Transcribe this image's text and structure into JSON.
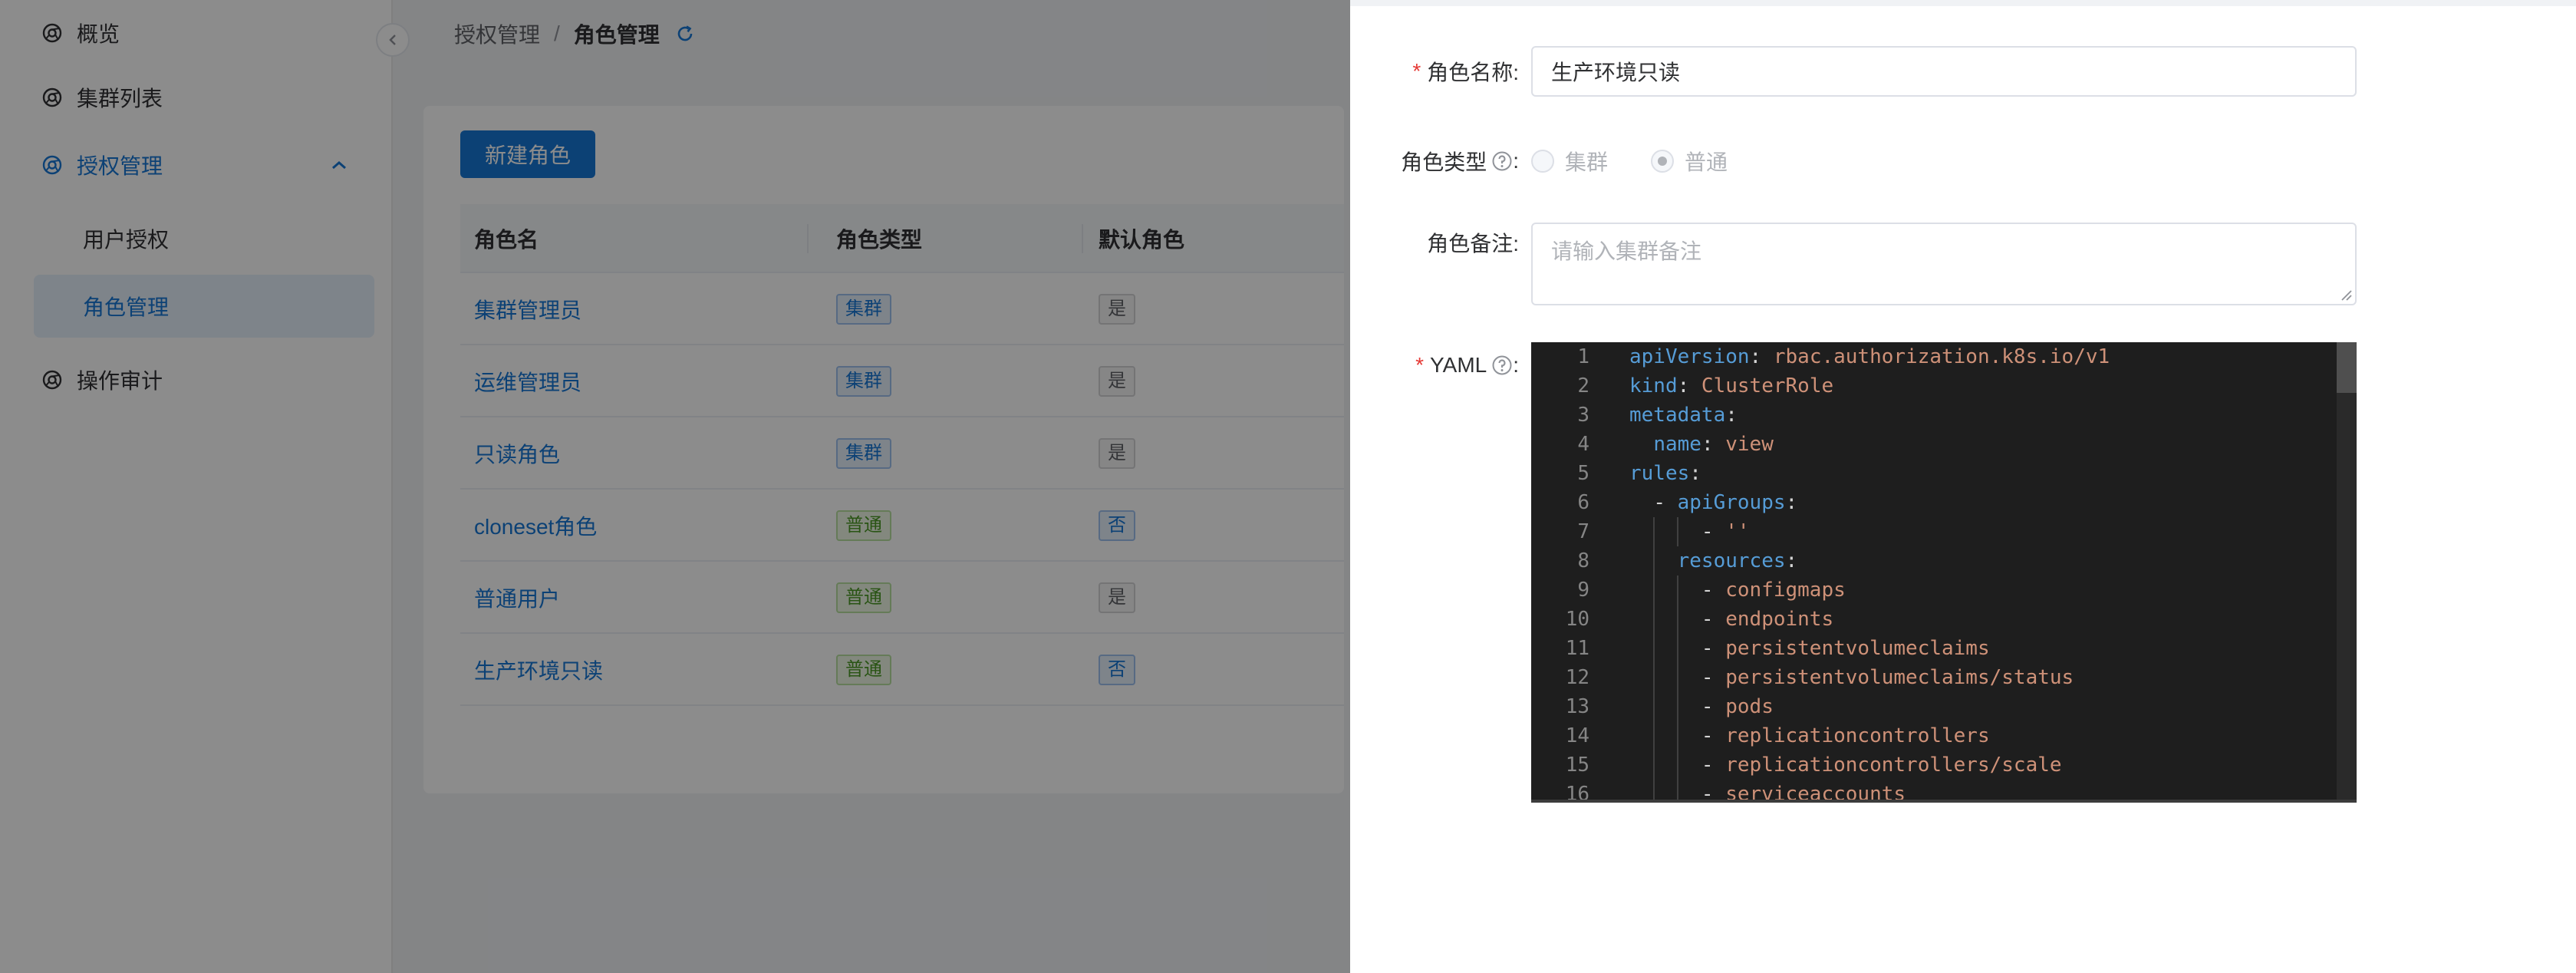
{
  "sidebar": {
    "items": [
      {
        "label": "概览"
      },
      {
        "label": "集群列表"
      },
      {
        "label": "授权管理"
      },
      {
        "label": "操作审计"
      }
    ],
    "sub_items": [
      {
        "label": "用户授权"
      },
      {
        "label": "角色管理"
      }
    ]
  },
  "breadcrumb": {
    "parent": "授权管理",
    "separator": "/",
    "current": "角色管理"
  },
  "toolbar": {
    "new_role_label": "新建角色"
  },
  "table": {
    "columns": [
      "角色名",
      "角色类型",
      "默认角色"
    ],
    "rows": [
      {
        "name": "集群管理员",
        "type": "集群",
        "default": "是"
      },
      {
        "name": "运维管理员",
        "type": "集群",
        "default": "是"
      },
      {
        "name": "只读角色",
        "type": "集群",
        "default": "是"
      },
      {
        "name": "cloneset角色",
        "type": "普通",
        "default": "否"
      },
      {
        "name": "普通用户",
        "type": "普通",
        "default": "是"
      },
      {
        "name": "生产环境只读",
        "type": "普通",
        "default": "否"
      }
    ]
  },
  "drawer": {
    "role_name_label": "角色名称:",
    "role_name_value": "生产环境只读",
    "role_type_label": "角色类型",
    "role_type_colon": ":",
    "role_type_options": [
      "集群",
      "普通"
    ],
    "role_type_selected": "普通",
    "remark_label": "角色备注:",
    "remark_placeholder": "请输入集群备注",
    "yaml_label": "YAML",
    "yaml_colon": ":"
  },
  "yaml_lines": [
    "apiVersion: rbac.authorization.k8s.io/v1",
    "kind: ClusterRole",
    "metadata:",
    "  name: view",
    "rules:",
    "  - apiGroups:",
    "      - ''",
    "    resources:",
    "      - configmaps",
    "      - endpoints",
    "      - persistentvolumeclaims",
    "      - persistentvolumeclaims/status",
    "      - pods",
    "      - replicationcontrollers",
    "      - replicationcontrollers/scale",
    "      - serviceaccounts"
  ],
  "colors": {
    "accent": "#1677d6",
    "required": "#e53935",
    "editor_bg": "#1e1e1e",
    "yaml_key": "#569cd6",
    "yaml_value": "#ce9178"
  }
}
